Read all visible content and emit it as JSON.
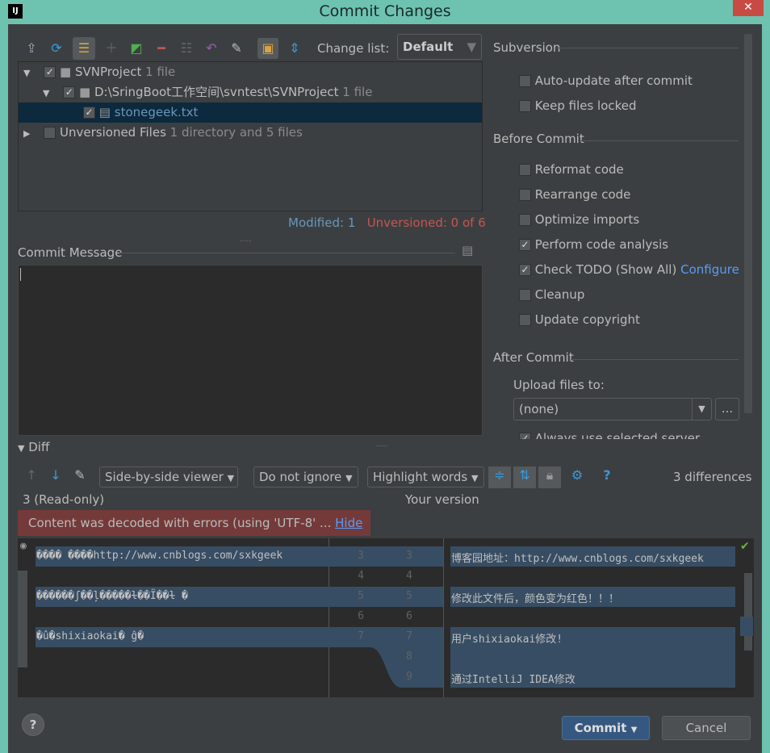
{
  "window": {
    "title": "Commit Changes",
    "app_icon": "IJ",
    "close_icon": "close-icon"
  },
  "toolbar": {
    "changelist_label": "Change list:",
    "changelist_value": "Default"
  },
  "tree": [
    {
      "label": "SVNProject",
      "extra": "1 file",
      "checked": true
    },
    {
      "label": "D:\\SringBoot工作空间\\svntest\\SVNProject",
      "extra": "1 file",
      "checked": true
    },
    {
      "label": "stonegeek.txt",
      "extra": "",
      "checked": true
    },
    {
      "label": "Unversioned Files",
      "extra": "1 directory and 5 files",
      "checked": false
    }
  ],
  "status": {
    "modified": "Modified: 1",
    "unversioned": "Unversioned: 0 of 6"
  },
  "commit_message": {
    "label": "Commit Message",
    "value": ""
  },
  "subversion": {
    "title": "Subversion",
    "options": [
      {
        "label": "Auto-update after commit",
        "checked": false
      },
      {
        "label": "Keep files locked",
        "checked": false
      }
    ]
  },
  "before_commit": {
    "title": "Before Commit",
    "options": [
      {
        "label": "Reformat code",
        "checked": false
      },
      {
        "label": "Rearrange code",
        "checked": false
      },
      {
        "label": "Optimize imports",
        "checked": false
      },
      {
        "label": "Perform code analysis",
        "checked": true
      },
      {
        "label": "Check TODO (Show All)",
        "checked": true
      },
      {
        "label": "Cleanup",
        "checked": false
      },
      {
        "label": "Update copyright",
        "checked": false
      }
    ],
    "configure": "Configure"
  },
  "after_commit": {
    "title": "After Commit",
    "upload_label": "Upload files to:",
    "upload_value": "(none)",
    "more": "...",
    "partial": "Always use selected server"
  },
  "diff": {
    "title": "Diff",
    "viewer": "Side-by-side viewer",
    "ignore": "Do not ignore",
    "highlight": "Highlight words",
    "count": "3 differences",
    "left_title": "3 (Read-only)",
    "right_title": "Your version",
    "warning": "Content was decoded with errors (using 'UTF-8' ...",
    "hide": "Hide",
    "left_lines": [
      "���� ����http://www.cnblogs.com/sxkgeek",
      "",
      "������ʃ��ļ�����ɫ��Ϊ��ɫ  �",
      "",
      "�û�shixiaokai�  ĝ�"
    ],
    "left_nums": [
      "3",
      "4",
      "5",
      "6",
      "7"
    ],
    "right_nums": [
      "3",
      "4",
      "5",
      "6",
      "7",
      "8",
      "9"
    ],
    "right_lines": [
      "博客园地址：http://www.cnblogs.com/sxkgeek",
      "",
      "修改此文件后，颜色变为红色！！！",
      "",
      "用户shixiaokai修改!",
      "",
      "通过IntelliJ IDEA修改"
    ]
  },
  "buttons": {
    "commit": "Commit",
    "cancel": "Cancel",
    "help": "?"
  }
}
